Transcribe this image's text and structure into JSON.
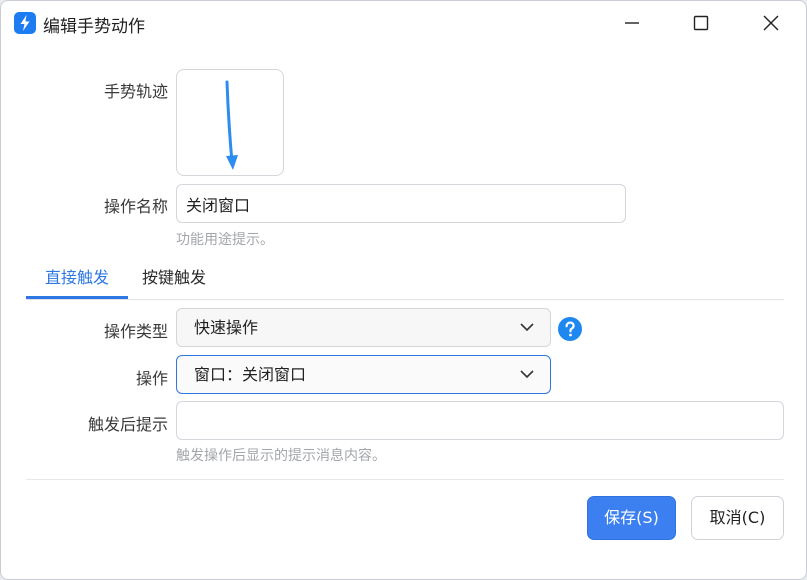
{
  "window": {
    "title": "编辑手势动作",
    "controls": [
      "minimize",
      "maximize",
      "close"
    ]
  },
  "form": {
    "gesture_label": "手势轨迹",
    "name_label": "操作名称",
    "name_value": "关闭窗口",
    "name_hint": "功能用途提示。",
    "tabs": [
      {
        "label": "直接触发",
        "active": true
      },
      {
        "label": "按键触发",
        "active": false
      }
    ],
    "type_label": "操作类型",
    "type_value": "快速操作",
    "action_label": "操作",
    "action_value": "窗口：关闭窗口",
    "tip_label": "触发后提示",
    "tip_value": "",
    "tip_hint": "触发操作后显示的提示消息内容。"
  },
  "buttons": {
    "save": "保存(S)",
    "cancel": "取消(C)"
  },
  "colors": {
    "accent": "#2f78e4",
    "primary_button": "#3b7ff0",
    "gesture_stroke": "#2d8cf0",
    "help_icon": "#1e88f0"
  },
  "icons": {
    "app": "lightning-icon",
    "help": "question-circle-icon",
    "dropdown": "chevron-down-icon"
  }
}
